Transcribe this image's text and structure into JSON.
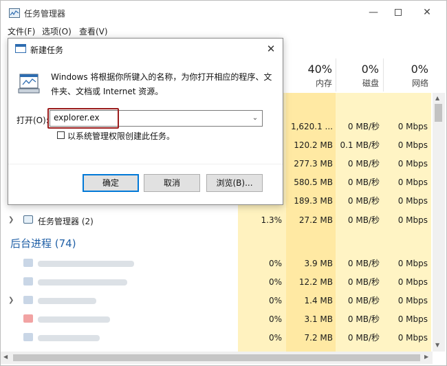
{
  "window": {
    "title": "任务管理器",
    "controls": {
      "minimize": "—",
      "close": "✕"
    }
  },
  "menu": [
    "文件(F)",
    "选项(O)",
    "查看(V)"
  ],
  "columns": {
    "memory": {
      "pct": "40%",
      "label": "内存"
    },
    "disk": {
      "pct": "0%",
      "label": "磁盘"
    },
    "network": {
      "pct": "0%",
      "label": "网络"
    }
  },
  "app_rows": [
    {
      "cpu": "",
      "memory": "1,620.1 ...",
      "disk": "0 MB/秒",
      "network": "0 Mbps"
    },
    {
      "cpu": "",
      "memory": "120.2 MB",
      "disk": "0.1 MB/秒",
      "network": "0 Mbps"
    },
    {
      "cpu": "",
      "memory": "277.3 MB",
      "disk": "0 MB/秒",
      "network": "0 Mbps"
    },
    {
      "cpu": "",
      "memory": "580.5 MB",
      "disk": "0 MB/秒",
      "network": "0 Mbps"
    },
    {
      "cpu": "",
      "memory": "189.3 MB",
      "disk": "0 MB/秒",
      "network": "0 Mbps"
    },
    {
      "name": "任务管理器 (2)",
      "cpu": "1.3%",
      "memory": "27.2 MB",
      "disk": "0 MB/秒",
      "network": "0 Mbps"
    }
  ],
  "background_group": {
    "title": "后台进程 (74)"
  },
  "background_rows": [
    {
      "cpu": "0%",
      "memory": "3.9 MB",
      "disk": "0 MB/秒",
      "network": "0 Mbps"
    },
    {
      "cpu": "0%",
      "memory": "12.2 MB",
      "disk": "0 MB/秒",
      "network": "0 Mbps"
    },
    {
      "cpu": "0%",
      "memory": "1.4 MB",
      "disk": "0 MB/秒",
      "network": "0 Mbps"
    },
    {
      "cpu": "0%",
      "memory": "3.1 MB",
      "disk": "0 MB/秒",
      "network": "0 Mbps"
    },
    {
      "cpu": "0%",
      "memory": "7.2 MB",
      "disk": "0 MB/秒",
      "network": "0 Mbps"
    }
  ],
  "run_dialog": {
    "title": "新建任务",
    "description": "Windows 将根据你所键入的名称，为你打开相应的程序、文件夹、文档或 Internet 资源。",
    "open_label": "打开(O):",
    "open_value": "explorer.ex",
    "admin_checkbox_label": "以系统管理权限创建此任务。",
    "ok_label": "确定",
    "cancel_label": "取消",
    "browse_label": "浏览(B)..."
  },
  "colors": {
    "heat_cell": "#fff4c4",
    "heat_cell_strong": "#ffe9a3",
    "group_title": "#1f5fa6",
    "highlight": "#9b1c1c",
    "ok_border": "#0078d7"
  }
}
